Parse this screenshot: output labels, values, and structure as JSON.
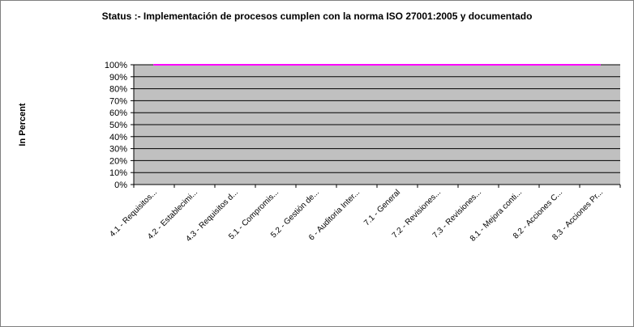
{
  "chart_data": {
    "type": "line",
    "title": "Status :- Implementación de procesos cumplen con la norma ISO 27001:2005 y documentado",
    "xlabel": "",
    "ylabel": "In Percent",
    "ylim": [
      0,
      100
    ],
    "yticks": [
      "0%",
      "10%",
      "20%",
      "30%",
      "40%",
      "50%",
      "60%",
      "70%",
      "80%",
      "90%",
      "100%"
    ],
    "categories": [
      "4.1 - Requisitos...",
      "4.2 - Establecimi...",
      "4.3 - Requisitos d...",
      "5.1 - Compromis...",
      "5.2 - Gestión de...",
      "6 - Auditoria Inter...",
      "7.1 - General",
      "7.2 - Revisiones...",
      "7.3 - Revisiones...",
      "8.1 - Mejora conti...",
      "8.2 - Acciones C...",
      "8.3 - Acciones Pr..."
    ],
    "series": [
      {
        "values": [
          100,
          100,
          100,
          100,
          100,
          100,
          100,
          100,
          100,
          100,
          100,
          100
        ],
        "color": "#ff00ff"
      }
    ],
    "grid": true,
    "legend": "none",
    "colors": {
      "plot_background": "#c0c0c0",
      "gridline": "#000000",
      "series": "#ff00ff"
    }
  }
}
